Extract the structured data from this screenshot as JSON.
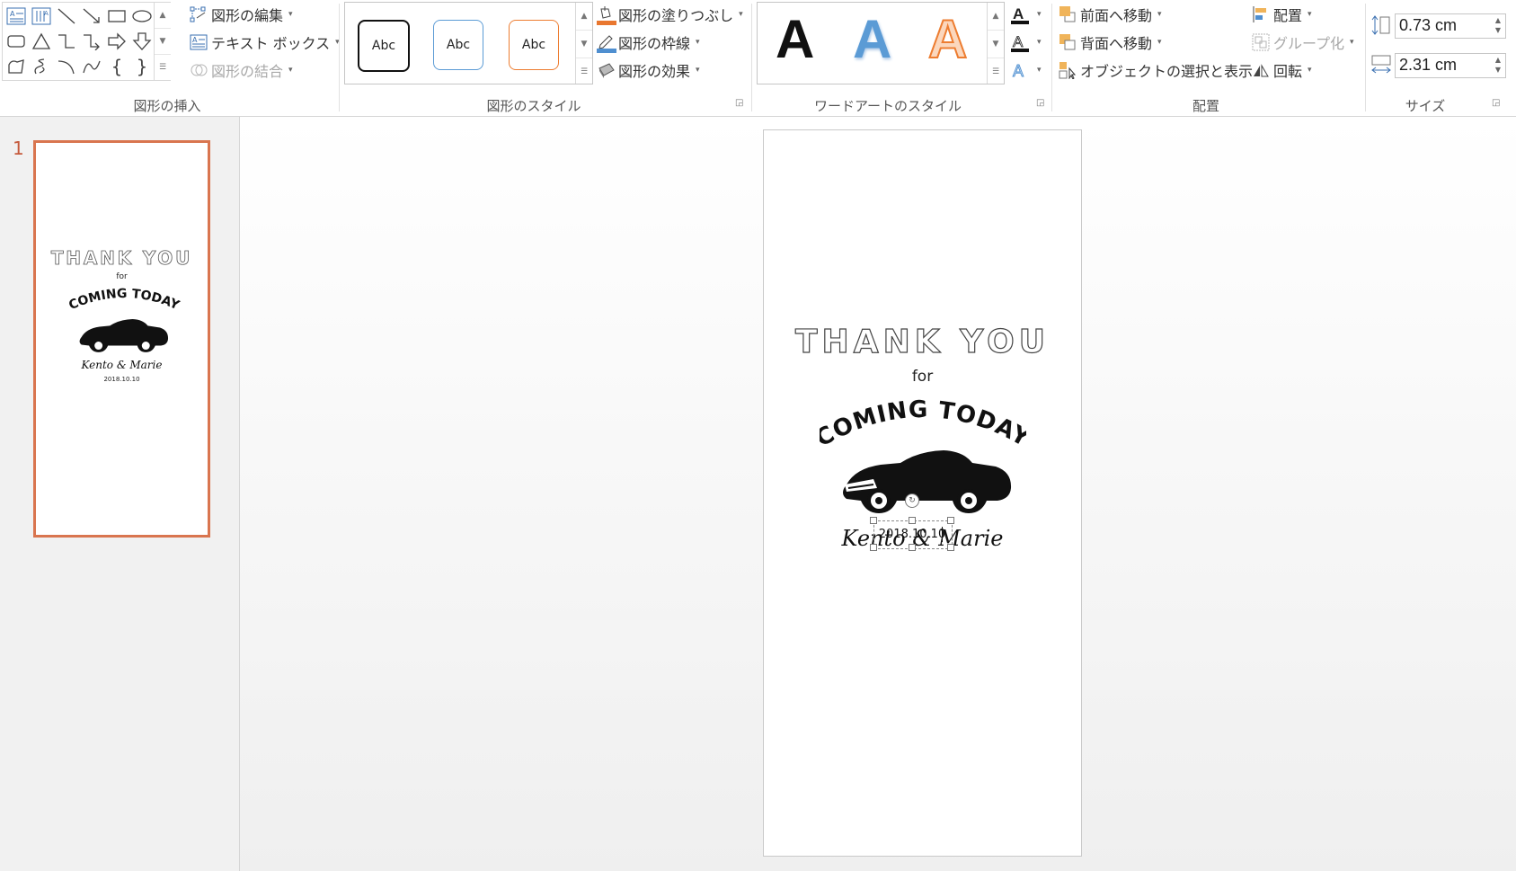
{
  "ribbon": {
    "insert_shapes": {
      "label": "図形の挿入",
      "edit_shape": "図形の編集",
      "text_box": "テキスト ボックス",
      "merge_shapes": "図形の結合"
    },
    "shape_styles": {
      "label": "図形のスタイル",
      "presets": [
        "Abc",
        "Abc",
        "Abc"
      ],
      "fill": "図形の塗りつぶし",
      "outline": "図形の枠線",
      "effects": "図形の効果"
    },
    "wordart": {
      "label": "ワードアートのスタイル",
      "sample": "A"
    },
    "arrange": {
      "label": "配置",
      "bring_forward": "前面へ移動",
      "send_backward": "背面へ移動",
      "selection_pane": "オブジェクトの選択と表示",
      "align": "配置",
      "group": "グループ化",
      "rotate": "回転"
    },
    "size": {
      "label": "サイズ",
      "height": "0.73 cm",
      "width": "2.31 cm"
    }
  },
  "slides_pane": {
    "slide_number": "1"
  },
  "slide": {
    "title": "THANK YOU",
    "for_text": "for",
    "subtitle": "COMING TODAY",
    "names": "Kento & Marie",
    "date": "2018.10.10"
  },
  "colors": {
    "accent": "#d9754f",
    "shape_fill_bar": "#e9772f",
    "shape_outline_bar": "#4f8fd0",
    "wordart_blue": "#5b9bd5",
    "wordart_orange": "#ed7d31"
  }
}
